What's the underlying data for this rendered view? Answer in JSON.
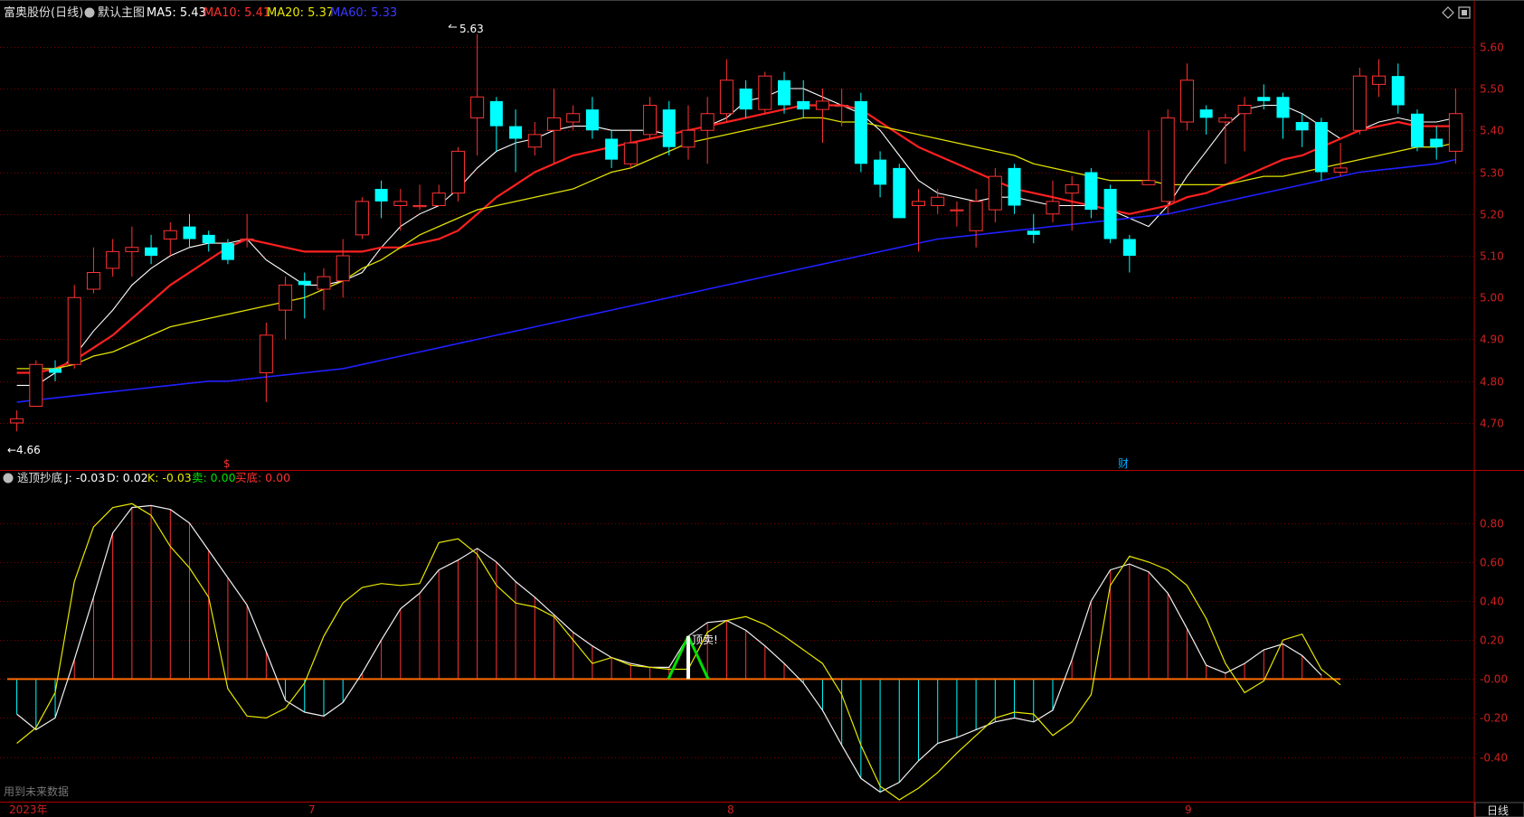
{
  "header": {
    "stock_title": "富奥股份(日线)",
    "main_chart_label": "默认主图",
    "ma5_label": "MA5: 5.43",
    "ma10_label": "MA10: 5.41",
    "ma20_label": "MA20: 5.37",
    "ma60_label": "MA60: 5.33"
  },
  "indicator_header": {
    "name": "逃顶抄底",
    "j_label": "J: -0.03",
    "d_label": "D: 0.02",
    "k_label": "K: -0.03",
    "sell_label": "卖: 0.00",
    "buy_label": "买底: 0.00"
  },
  "footer": {
    "future_data_note": "用到未来数据",
    "period_button": "日线",
    "date_labels": [
      "2023年",
      "7",
      "8",
      "9"
    ]
  },
  "annotations": {
    "high_label": "5.63",
    "low_label": "←4.66",
    "top_sell_label": "顶卖!",
    "marker_dollar": "$",
    "marker_finance": "财"
  },
  "colors": {
    "up": "#ff3232",
    "down": "#00ffff",
    "ma5": "#ffffff",
    "ma10": "#ff2020",
    "ma20": "#e0e000",
    "ma60": "#2020ff",
    "grid": "#7a0000",
    "axis_text": "#d02020"
  },
  "chart_data": [
    {
      "type": "candlestick",
      "title": "富奥股份(日线)",
      "ylim": [
        4.62,
        5.66
      ],
      "y_ticks": [
        4.7,
        4.8,
        4.9,
        5.0,
        5.1,
        5.2,
        5.3,
        5.4,
        5.5,
        5.6
      ],
      "candles": [
        [
          4.7,
          4.71,
          4.73,
          4.68
        ],
        [
          4.74,
          4.84,
          4.85,
          4.74
        ],
        [
          4.83,
          4.82,
          4.85,
          4.8
        ],
        [
          4.84,
          5.0,
          5.03,
          4.83
        ],
        [
          5.02,
          5.06,
          5.12,
          5.01
        ],
        [
          5.07,
          5.11,
          5.14,
          5.05
        ],
        [
          5.11,
          5.12,
          5.17,
          5.05
        ],
        [
          5.12,
          5.1,
          5.15,
          5.08
        ],
        [
          5.14,
          5.16,
          5.18,
          5.1
        ],
        [
          5.17,
          5.14,
          5.2,
          5.12
        ],
        [
          5.15,
          5.13,
          5.16,
          5.11
        ],
        [
          5.13,
          5.09,
          5.14,
          5.08
        ],
        [
          5.14,
          5.14,
          5.2,
          5.12
        ],
        [
          4.82,
          4.91,
          4.94,
          4.75
        ],
        [
          4.97,
          5.03,
          5.05,
          4.9
        ],
        [
          5.04,
          5.03,
          5.06,
          4.95
        ],
        [
          5.02,
          5.05,
          5.07,
          4.97
        ],
        [
          5.04,
          5.1,
          5.14,
          5.0
        ],
        [
          5.15,
          5.23,
          5.24,
          5.14
        ],
        [
          5.26,
          5.23,
          5.28,
          5.19
        ],
        [
          5.22,
          5.23,
          5.26,
          5.16
        ],
        [
          5.22,
          5.22,
          5.27,
          5.21
        ],
        [
          5.22,
          5.25,
          5.27,
          5.22
        ],
        [
          5.25,
          5.35,
          5.36,
          5.23
        ],
        [
          5.43,
          5.48,
          5.63,
          5.34
        ],
        [
          5.47,
          5.41,
          5.48,
          5.35
        ],
        [
          5.41,
          5.38,
          5.45,
          5.3
        ],
        [
          5.36,
          5.39,
          5.42,
          5.34
        ],
        [
          5.4,
          5.43,
          5.5,
          5.32
        ],
        [
          5.42,
          5.44,
          5.46,
          5.4
        ],
        [
          5.45,
          5.4,
          5.48,
          5.38
        ],
        [
          5.38,
          5.33,
          5.4,
          5.31
        ],
        [
          5.32,
          5.37,
          5.4,
          5.31
        ],
        [
          5.39,
          5.46,
          5.48,
          5.38
        ],
        [
          5.45,
          5.36,
          5.47,
          5.34
        ],
        [
          5.36,
          5.4,
          5.46,
          5.33
        ],
        [
          5.4,
          5.44,
          5.48,
          5.32
        ],
        [
          5.44,
          5.52,
          5.57,
          5.42
        ],
        [
          5.5,
          5.45,
          5.52,
          5.43
        ],
        [
          5.45,
          5.53,
          5.54,
          5.44
        ],
        [
          5.52,
          5.46,
          5.54,
          5.44
        ],
        [
          5.47,
          5.45,
          5.52,
          5.43
        ],
        [
          5.45,
          5.47,
          5.5,
          5.37
        ],
        [
          5.46,
          5.46,
          5.5,
          5.41
        ],
        [
          5.47,
          5.32,
          5.49,
          5.3
        ],
        [
          5.33,
          5.27,
          5.35,
          5.24
        ],
        [
          5.31,
          5.19,
          5.32,
          5.19
        ],
        [
          5.22,
          5.23,
          5.26,
          5.11
        ],
        [
          5.22,
          5.24,
          5.26,
          5.2
        ],
        [
          5.21,
          5.21,
          5.23,
          5.17
        ],
        [
          5.16,
          5.23,
          5.26,
          5.12
        ],
        [
          5.21,
          5.29,
          5.31,
          5.18
        ],
        [
          5.31,
          5.22,
          5.32,
          5.2
        ],
        [
          5.16,
          5.15,
          5.2,
          5.13
        ],
        [
          5.2,
          5.23,
          5.28,
          5.18
        ],
        [
          5.25,
          5.27,
          5.29,
          5.16
        ],
        [
          5.3,
          5.21,
          5.31,
          5.19
        ],
        [
          5.26,
          5.14,
          5.27,
          5.13
        ],
        [
          5.14,
          5.1,
          5.15,
          5.06
        ],
        [
          5.27,
          5.28,
          5.4,
          5.27
        ],
        [
          5.23,
          5.43,
          5.45,
          5.2
        ],
        [
          5.42,
          5.52,
          5.56,
          5.4
        ],
        [
          5.45,
          5.43,
          5.46,
          5.39
        ],
        [
          5.42,
          5.43,
          5.44,
          5.32
        ],
        [
          5.44,
          5.46,
          5.48,
          5.35
        ],
        [
          5.48,
          5.47,
          5.51,
          5.45
        ],
        [
          5.48,
          5.43,
          5.49,
          5.38
        ],
        [
          5.42,
          5.4,
          5.44,
          5.36
        ],
        [
          5.42,
          5.3,
          5.43,
          5.28
        ],
        [
          5.3,
          5.31,
          5.37,
          5.29
        ],
        [
          5.4,
          5.53,
          5.55,
          5.39
        ],
        [
          5.51,
          5.53,
          5.57,
          5.48
        ],
        [
          5.53,
          5.46,
          5.56,
          5.44
        ],
        [
          5.44,
          5.36,
          5.45,
          5.35
        ],
        [
          5.38,
          5.36,
          5.41,
          5.33
        ],
        [
          5.35,
          5.44,
          5.5,
          5.32
        ]
      ],
      "series": [
        {
          "name": "MA5",
          "values": [
            4.79,
            4.79,
            4.82,
            4.86,
            4.92,
            4.97,
            5.03,
            5.07,
            5.1,
            5.12,
            5.13,
            5.13,
            5.14,
            5.09,
            5.06,
            5.03,
            5.03,
            5.04,
            5.06,
            5.12,
            5.17,
            5.2,
            5.22,
            5.26,
            5.31,
            5.35,
            5.37,
            5.38,
            5.4,
            5.41,
            5.41,
            5.4,
            5.4,
            5.4,
            5.39,
            5.4,
            5.41,
            5.43,
            5.47,
            5.48,
            5.5,
            5.5,
            5.48,
            5.46,
            5.44,
            5.4,
            5.34,
            5.28,
            5.25,
            5.24,
            5.23,
            5.24,
            5.24,
            5.23,
            5.22,
            5.22,
            5.22,
            5.21,
            5.19,
            5.17,
            5.22,
            5.29,
            5.35,
            5.41,
            5.45,
            5.46,
            5.46,
            5.44,
            5.41,
            5.38,
            5.4,
            5.42,
            5.43,
            5.42,
            5.42,
            5.43
          ]
        },
        {
          "name": "MA10",
          "values": [
            4.82,
            4.82,
            4.83,
            4.85,
            4.88,
            4.91,
            4.95,
            4.99,
            5.03,
            5.06,
            5.09,
            5.12,
            5.14,
            5.13,
            5.12,
            5.11,
            5.11,
            5.11,
            5.11,
            5.12,
            5.12,
            5.13,
            5.14,
            5.16,
            5.2,
            5.24,
            5.27,
            5.3,
            5.32,
            5.34,
            5.35,
            5.36,
            5.37,
            5.38,
            5.39,
            5.4,
            5.41,
            5.42,
            5.43,
            5.44,
            5.45,
            5.46,
            5.46,
            5.46,
            5.45,
            5.42,
            5.39,
            5.36,
            5.34,
            5.32,
            5.3,
            5.28,
            5.26,
            5.25,
            5.24,
            5.23,
            5.22,
            5.21,
            5.2,
            5.21,
            5.22,
            5.24,
            5.25,
            5.27,
            5.29,
            5.31,
            5.33,
            5.34,
            5.36,
            5.38,
            5.4,
            5.41,
            5.42,
            5.41,
            5.41,
            5.41
          ]
        },
        {
          "name": "MA20",
          "values": [
            4.83,
            4.83,
            4.83,
            4.84,
            4.86,
            4.87,
            4.89,
            4.91,
            4.93,
            4.94,
            4.95,
            4.96,
            4.97,
            4.98,
            4.99,
            5.0,
            5.02,
            5.04,
            5.07,
            5.09,
            5.12,
            5.15,
            5.17,
            5.19,
            5.21,
            5.22,
            5.23,
            5.24,
            5.25,
            5.26,
            5.28,
            5.3,
            5.31,
            5.33,
            5.35,
            5.37,
            5.38,
            5.39,
            5.4,
            5.41,
            5.42,
            5.43,
            5.43,
            5.42,
            5.42,
            5.41,
            5.4,
            5.39,
            5.38,
            5.37,
            5.36,
            5.35,
            5.34,
            5.32,
            5.31,
            5.3,
            5.29,
            5.28,
            5.28,
            5.28,
            5.27,
            5.27,
            5.27,
            5.27,
            5.28,
            5.29,
            5.29,
            5.3,
            5.31,
            5.32,
            5.33,
            5.34,
            5.35,
            5.36,
            5.36,
            5.37
          ]
        },
        {
          "name": "MA60",
          "values": [
            4.75,
            4.755,
            4.76,
            4.765,
            4.77,
            4.775,
            4.78,
            4.785,
            4.79,
            4.795,
            4.8,
            4.8,
            4.805,
            4.81,
            4.815,
            4.82,
            4.825,
            4.83,
            4.84,
            4.85,
            4.86,
            4.87,
            4.88,
            4.89,
            4.9,
            4.91,
            4.92,
            4.93,
            4.94,
            4.95,
            4.96,
            4.97,
            4.98,
            4.99,
            5.0,
            5.01,
            5.02,
            5.03,
            5.04,
            5.05,
            5.06,
            5.07,
            5.08,
            5.09,
            5.1,
            5.11,
            5.12,
            5.13,
            5.14,
            5.145,
            5.15,
            5.155,
            5.16,
            5.165,
            5.17,
            5.175,
            5.18,
            5.185,
            5.19,
            5.195,
            5.2,
            5.21,
            5.22,
            5.23,
            5.24,
            5.25,
            5.26,
            5.27,
            5.28,
            5.29,
            5.3,
            5.305,
            5.31,
            5.315,
            5.32,
            5.33
          ]
        }
      ]
    },
    {
      "type": "line",
      "title": "逃顶抄底",
      "ylim": [
        -0.62,
        0.98
      ],
      "y_ticks": [
        0.8,
        0.6,
        0.4,
        0.2,
        0.0,
        -0.2,
        -0.4
      ],
      "y_tick_labels": [
        "0.80",
        "0.60",
        "0.40",
        "0.20",
        "-0.00",
        "-0.20",
        "-0.40"
      ],
      "bar_color_positive": "#ff3232",
      "bar_color_negative": "#00ffff",
      "signal_index": 35,
      "series": [
        {
          "name": "J",
          "values": [
            -0.33,
            -0.25,
            -0.07,
            0.5,
            0.78,
            0.88,
            0.9,
            0.84,
            0.68,
            0.57,
            0.42,
            -0.05,
            -0.19,
            -0.2,
            -0.15,
            -0.02,
            0.22,
            0.39,
            0.47,
            0.49,
            0.48,
            0.49,
            0.7,
            0.72,
            0.64,
            0.48,
            0.39,
            0.37,
            0.32,
            0.2,
            0.08,
            0.11,
            0.07,
            0.06,
            0.05,
            0.05,
            0.24,
            0.3,
            0.32,
            0.28,
            0.22,
            0.15,
            0.08,
            -0.08,
            -0.34,
            -0.55,
            -0.62,
            -0.56,
            -0.48,
            -0.38,
            -0.29,
            -0.2,
            -0.17,
            -0.18,
            -0.29,
            -0.22,
            -0.08,
            0.48,
            0.63,
            0.6,
            0.56,
            0.48,
            0.31,
            0.08,
            -0.07,
            -0.01,
            0.2,
            0.23,
            0.05,
            -0.03
          ]
        },
        {
          "name": "D",
          "values": [
            -0.18,
            -0.26,
            -0.2,
            0.1,
            0.42,
            0.75,
            0.88,
            0.89,
            0.87,
            0.8,
            0.66,
            0.52,
            0.38,
            0.14,
            -0.11,
            -0.17,
            -0.19,
            -0.12,
            0.03,
            0.2,
            0.36,
            0.44,
            0.56,
            0.61,
            0.67,
            0.6,
            0.5,
            0.42,
            0.33,
            0.24,
            0.17,
            0.11,
            0.08,
            0.06,
            0.06,
            0.22,
            0.29,
            0.3,
            0.25,
            0.17,
            0.08,
            -0.02,
            -0.16,
            -0.34,
            -0.51,
            -0.58,
            -0.53,
            -0.42,
            -0.33,
            -0.3,
            -0.26,
            -0.22,
            -0.2,
            -0.22,
            -0.16,
            0.1,
            0.4,
            0.56,
            0.59,
            0.55,
            0.44,
            0.26,
            0.07,
            0.03,
            0.08,
            0.15,
            0.18,
            0.12,
            0.02
          ]
        },
        {
          "name": "K",
          "values": [
            -0.33,
            -0.25,
            -0.07,
            0.5,
            0.78,
            0.88,
            0.9,
            0.84,
            0.68,
            0.57,
            0.42,
            -0.05,
            -0.19,
            -0.2,
            -0.15,
            -0.02,
            0.22,
            0.39,
            0.47,
            0.49,
            0.48,
            0.49,
            0.7,
            0.72,
            0.64,
            0.48,
            0.39,
            0.37,
            0.32,
            0.2,
            0.08,
            0.11,
            0.07,
            0.06,
            0.05,
            0.05,
            0.24,
            0.3,
            0.32,
            0.28,
            0.22,
            0.15,
            0.08,
            -0.08,
            -0.34,
            -0.55,
            -0.62,
            -0.56,
            -0.48,
            -0.38,
            -0.29,
            -0.2,
            -0.17,
            -0.18,
            -0.29,
            -0.22,
            -0.08,
            0.48,
            0.63,
            0.6,
            0.56,
            0.48,
            0.31,
            0.08,
            -0.07,
            -0.01,
            0.2,
            0.23,
            0.05,
            -0.03
          ]
        }
      ]
    }
  ]
}
